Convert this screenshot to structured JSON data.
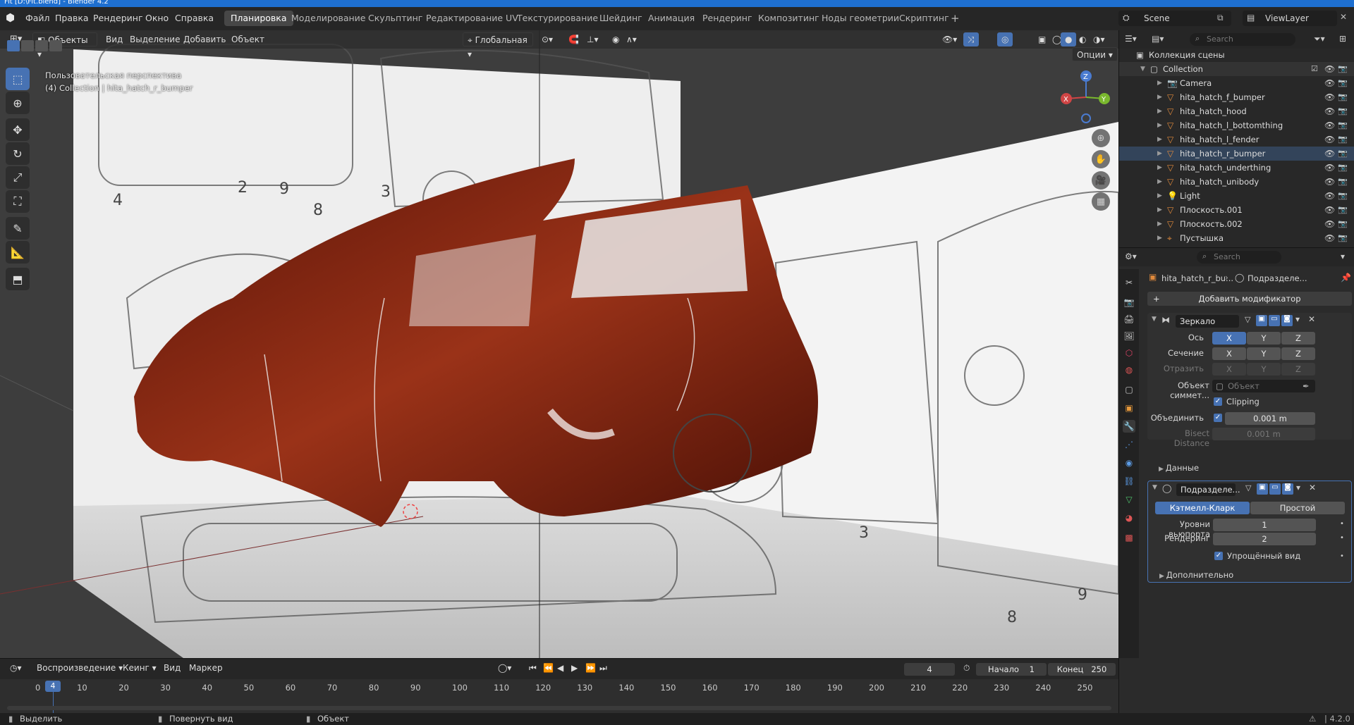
{
  "window": {
    "title": "Fit [D:\\Fit.blend] - Blender 4.2"
  },
  "menubar": {
    "items": [
      "Файл",
      "Правка",
      "Рендеринг",
      "Окно",
      "Справка"
    ],
    "workspaces": [
      "Планировка",
      "Моделирование",
      "Скульптинг",
      "Редактирование UV",
      "Текстурирование",
      "Шейдинг",
      "Анимация",
      "Рендеринг",
      "Композитинг",
      "Ноды геометрии",
      "Скриптинг"
    ],
    "active_workspace": "Планировка",
    "scene": "Scene",
    "view_layer": "ViewLayer"
  },
  "viewport": {
    "mode": "Объекты",
    "menus": [
      "Вид",
      "Выделение",
      "Добавить",
      "Объект"
    ],
    "orientation": "Глобальная",
    "options_label": "Опции",
    "overlay_line1": "Пользовательская перспектива",
    "overlay_line2": "(4) Collection | hita_hatch_r_bumper",
    "gizmo": {
      "x": "X",
      "y": "Y",
      "z": "Z"
    }
  },
  "outliner": {
    "search_placeholder": "Search",
    "root": "Коллекция сцены",
    "collection": "Collection",
    "items": [
      {
        "name": "Camera",
        "icon": "camera-icon"
      },
      {
        "name": "hita_hatch_f_bumper",
        "icon": "mesh-icon"
      },
      {
        "name": "hita_hatch_hood",
        "icon": "mesh-icon"
      },
      {
        "name": "hita_hatch_l_bottomthing",
        "icon": "mesh-icon"
      },
      {
        "name": "hita_hatch_l_fender",
        "icon": "mesh-icon"
      },
      {
        "name": "hita_hatch_r_bumper",
        "icon": "mesh-icon"
      },
      {
        "name": "hita_hatch_underthing",
        "icon": "mesh-icon"
      },
      {
        "name": "hita_hatch_unibody",
        "icon": "mesh-icon"
      },
      {
        "name": "Light",
        "icon": "light-icon"
      },
      {
        "name": "Плоскость.001",
        "icon": "mesh-icon"
      },
      {
        "name": "Плоскость.002",
        "icon": "mesh-icon"
      },
      {
        "name": "Пустышка",
        "icon": "empty-icon"
      }
    ]
  },
  "properties": {
    "search_placeholder": "Search",
    "breadcrumb_object": "hita_hatch_r_bu...",
    "breadcrumb_modifier": "Подразделе...",
    "add_modifier": "Добавить модификатор",
    "mirror": {
      "name": "Зеркало",
      "axis_label": "Ось",
      "bisect_label": "Сечение",
      "flip_label": "Отразить",
      "x": "X",
      "y": "Y",
      "z": "Z",
      "mirror_object_label": "Объект симмет...",
      "mirror_object_placeholder": "Объект",
      "clipping": "Clipping",
      "merge_label": "Объединить",
      "merge_value": "0.001 m",
      "bisect_distance_label": "Bisect Distance",
      "bisect_distance_value": "0.001 m",
      "data_label": "Данные"
    },
    "subsurf": {
      "name": "Подразделе...",
      "catmull": "Кэтмелл-Кларк",
      "simple": "Простой",
      "viewport_levels_label": "Уровни вьюпорта",
      "viewport_levels": "1",
      "render_label": "Рендеринг",
      "render_levels": "2",
      "optimal_display": "Упрощённый вид",
      "advanced": "Дополнительно"
    }
  },
  "timeline": {
    "menus": [
      "Воспроизведение",
      "Кеинг",
      "Вид",
      "Маркер"
    ],
    "current_frame": "4",
    "start_label": "Начало",
    "start": "1",
    "end_label": "Конец",
    "end": "250",
    "ticks": [
      "0",
      "10",
      "20",
      "30",
      "40",
      "50",
      "60",
      "70",
      "80",
      "90",
      "100",
      "110",
      "120",
      "130",
      "140",
      "150",
      "160",
      "170",
      "180",
      "190",
      "200",
      "210",
      "220",
      "230",
      "240",
      "250"
    ]
  },
  "statusbar": {
    "select": "Выделить",
    "rotate": "Повернуть вид",
    "object": "Объект",
    "version": "4.2.0"
  },
  "colors": {
    "accent": "#4772b3",
    "car_body": "#8a2a14",
    "title_bar": "#1e6fd0"
  }
}
